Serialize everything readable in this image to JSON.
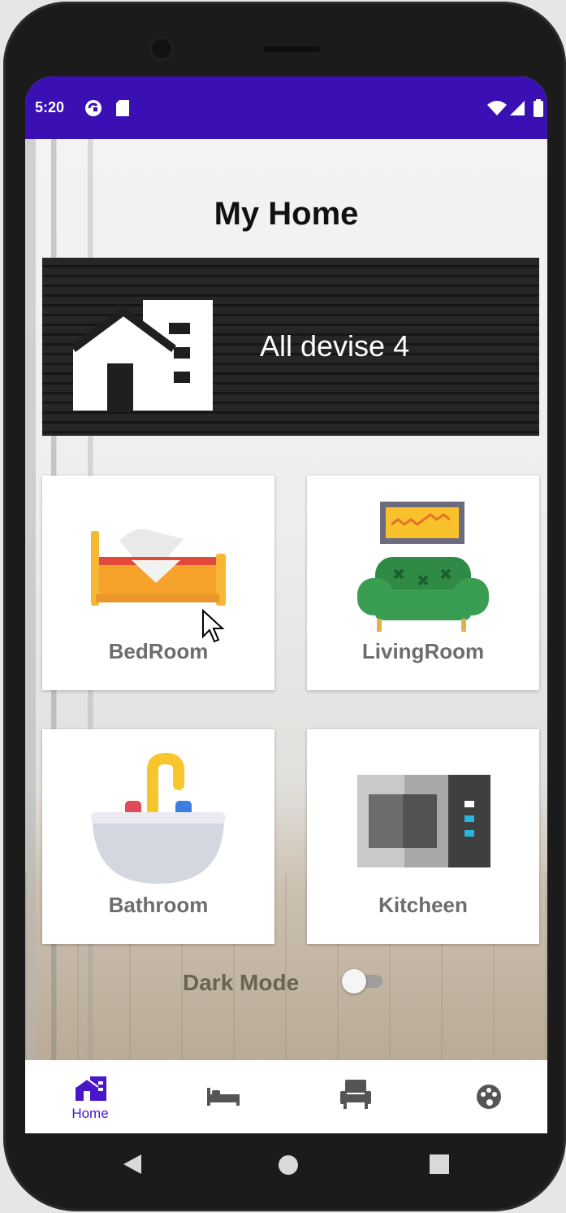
{
  "status_bar": {
    "time": "5:20",
    "color": "#3a0fb4"
  },
  "page": {
    "title": "My Home"
  },
  "banner": {
    "text": "All devise  4",
    "icon": "house-building-icon"
  },
  "rooms": [
    {
      "label": "BedRoom",
      "icon": "bed-icon"
    },
    {
      "label": "LivingRoom",
      "icon": "sofa-icon"
    },
    {
      "label": "Bathroom",
      "icon": "sink-icon"
    },
    {
      "label": "Kitcheen",
      "icon": "microwave-icon"
    }
  ],
  "dark_mode": {
    "label": "Dark Mode",
    "enabled": false
  },
  "bottom_nav": {
    "accent": "#4a16c9",
    "items": [
      {
        "label": "Home",
        "icon": "home-icon",
        "selected": true
      },
      {
        "label": "",
        "icon": "bed-icon",
        "selected": false
      },
      {
        "label": "",
        "icon": "armchair-icon",
        "selected": false
      },
      {
        "label": "",
        "icon": "palette-icon",
        "selected": false
      }
    ]
  }
}
